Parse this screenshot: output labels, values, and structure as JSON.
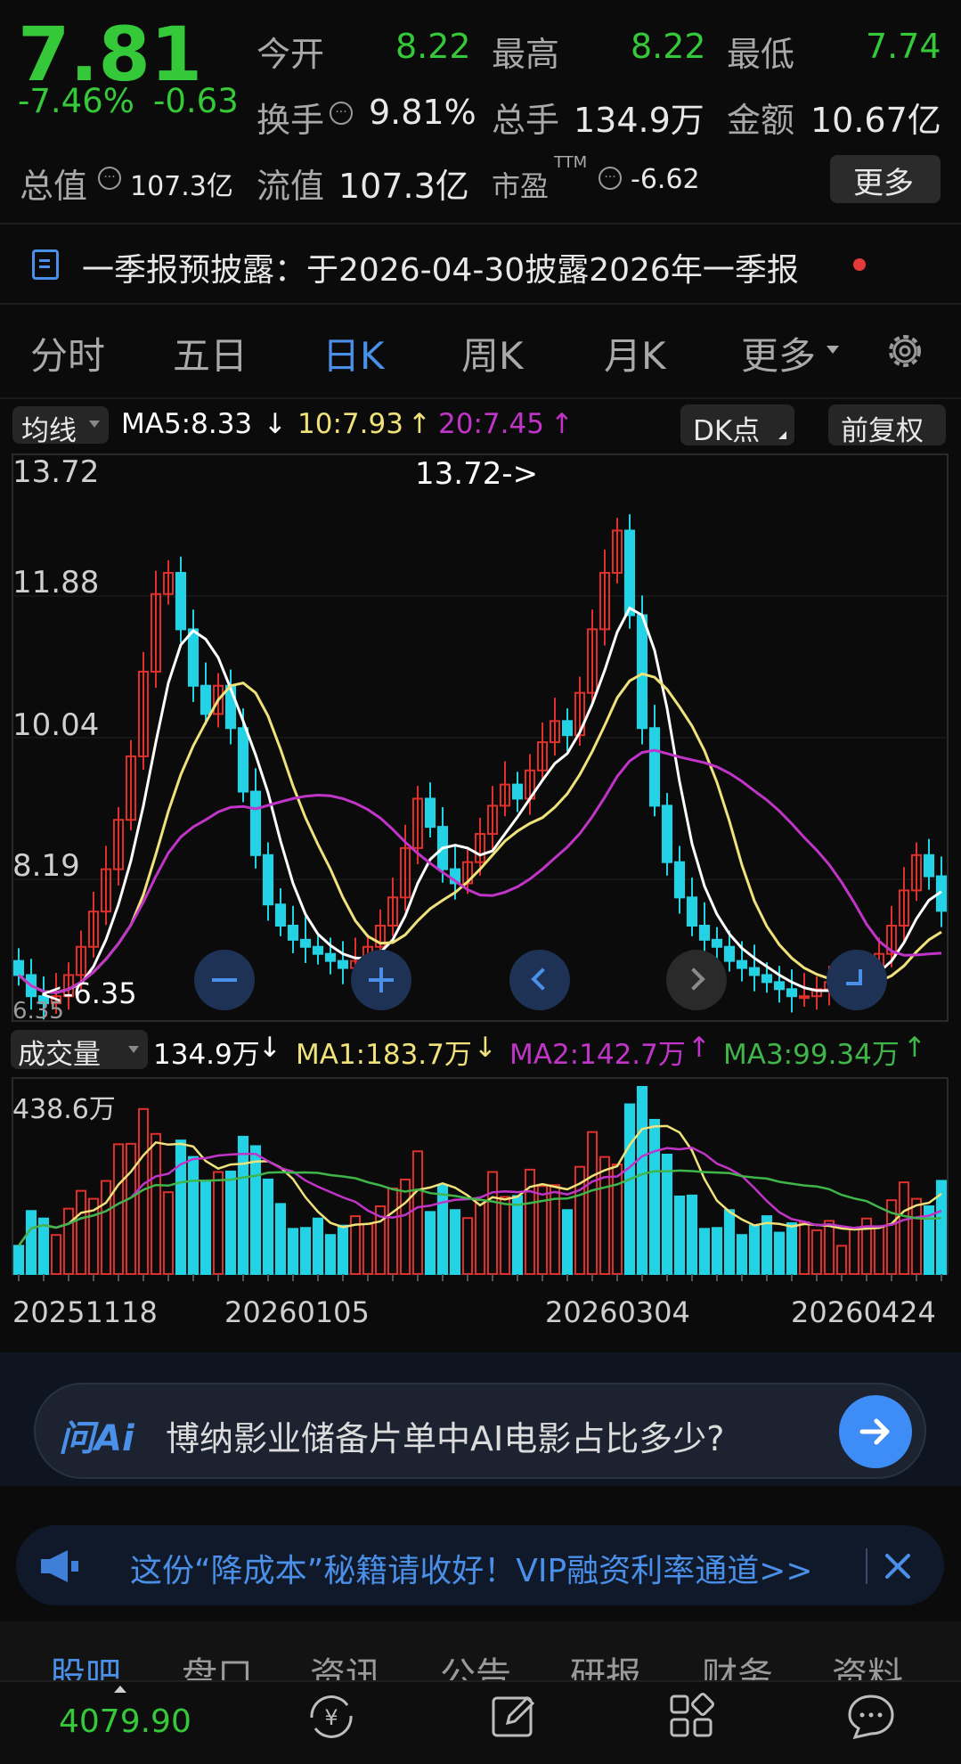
{
  "quote": {
    "price": "7.81",
    "change_pct": "-7.46%",
    "change_abs": "-0.63",
    "open_label": "今开",
    "open": "8.22",
    "high_label": "最高",
    "high": "8.22",
    "low_label": "最低",
    "low": "7.74",
    "turnover_label": "换手",
    "turnover": "9.81%",
    "volume_label": "总手",
    "volume": "134.9万",
    "amount_label": "金额",
    "amount": "10.67亿",
    "mktcap_label": "总值",
    "mktcap": "107.3亿",
    "float_label": "流值",
    "float": "107.3亿",
    "pe_label": "市盈",
    "pe_sup": "TTM",
    "pe": "-6.62",
    "more_button": "更多"
  },
  "notice": {
    "text": "一季报预披露：于2026-04-30披露2026年一季报"
  },
  "tabs": [
    "分时",
    "五日",
    "日K",
    "周K",
    "月K",
    "更多"
  ],
  "active_tab": "日K",
  "kline_toolbar": {
    "ma_select": "均线",
    "ma5": "MA5:8.33",
    "ma10": "10:7.93",
    "ma20": "20:7.45",
    "dk_button": "DK点",
    "adjust_button": "前复权"
  },
  "price_axis": {
    "labels": [
      "13.72",
      "11.88",
      "10.04",
      "8.19",
      "6.35"
    ],
    "max_marker": "13.72->",
    "min_marker": "<-6.35"
  },
  "volume_toolbar": {
    "select": "成交量",
    "vol": "134.9万",
    "ma1": "MA1:183.7万",
    "ma2": "MA2:142.7万",
    "ma3": "MA3:99.34万",
    "axis_max": "438.6万"
  },
  "date_axis": [
    "20251118",
    "20260105",
    "20260304",
    "20260424"
  ],
  "ai_bar": {
    "logo": "问Ai",
    "question": "博纳影业储备片单中AI电影占比多少?"
  },
  "promo": {
    "text": "这份“降成本”秘籍请收好！VIP融资利率通道>>"
  },
  "bottom_tabs": [
    "股吧",
    "盘口",
    "资讯",
    "公告",
    "研报",
    "财务",
    "资料"
  ],
  "index_bar": {
    "value": "4079.90"
  },
  "colors": {
    "up": "#e0302b",
    "down": "#22d3e6",
    "ma5": "#ffffff",
    "ma10": "#f0e27a",
    "ma20": "#c035c8",
    "ma3": "#3fb54a",
    "accent": "#4a8fe8",
    "fall_green": "#35c93a"
  },
  "chart_data": {
    "type": "candlestick",
    "x_dates": [
      "20251118",
      "20260105",
      "20260304",
      "20260424"
    ],
    "ylim": [
      6.35,
      13.72
    ],
    "close_series_approx": [
      6.9,
      6.6,
      6.5,
      6.6,
      6.9,
      7.3,
      7.8,
      8.4,
      9.1,
      10.0,
      11.2,
      12.3,
      12.6,
      11.8,
      11.0,
      10.6,
      11.0,
      10.4,
      9.5,
      8.6,
      7.9,
      7.6,
      7.4,
      7.3,
      7.2,
      7.1,
      7.0,
      7.1,
      7.3,
      7.6,
      8.0,
      8.7,
      9.4,
      9.0,
      8.4,
      8.2,
      8.5,
      8.9,
      9.3,
      9.6,
      9.4,
      9.8,
      10.2,
      10.5,
      10.3,
      10.9,
      11.8,
      12.6,
      13.2,
      12.0,
      10.4,
      9.3,
      8.5,
      8.0,
      7.6,
      7.4,
      7.3,
      7.1,
      7.0,
      6.9,
      6.8,
      6.7,
      6.6,
      6.6,
      6.7,
      6.8,
      6.8,
      6.9,
      7.0,
      7.2,
      7.6,
      8.1,
      8.6,
      8.3,
      7.81
    ],
    "volume_ylim_max": "438.6万"
  }
}
